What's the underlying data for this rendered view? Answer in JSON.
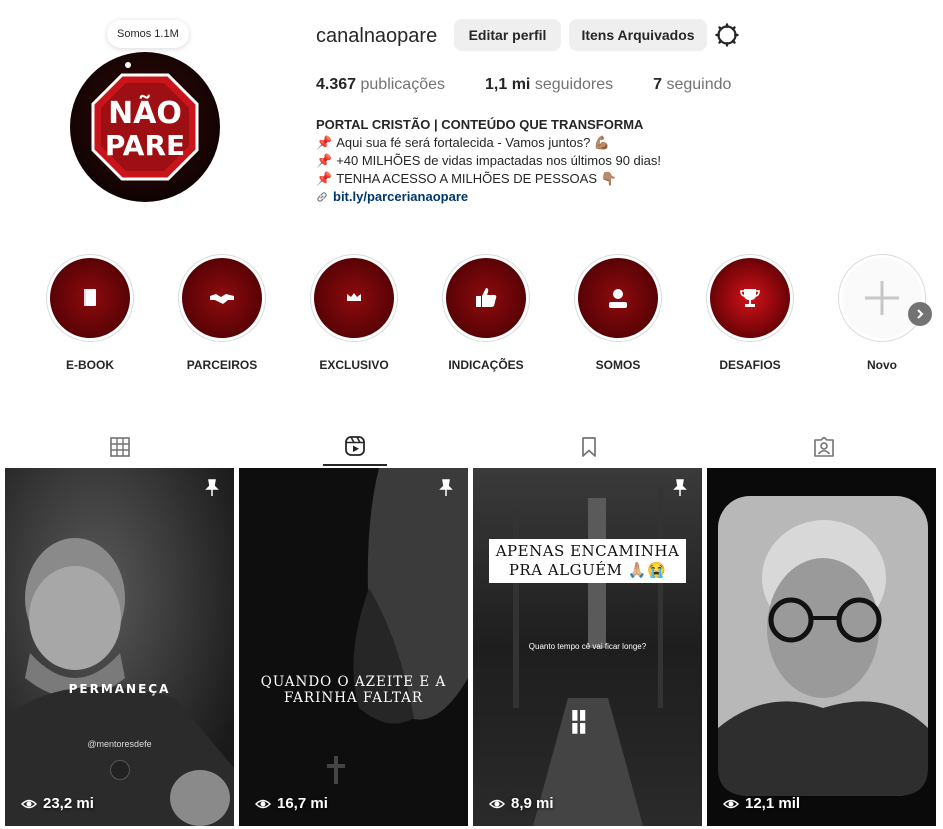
{
  "profile": {
    "username": "canalnaopare",
    "note": "Somos 1.1M",
    "avatar_text_top": "NÃO",
    "avatar_text_bottom": "PARE",
    "edit_label": "Editar perfil",
    "archive_label": "Itens Arquivados",
    "settings_icon": "gear-icon"
  },
  "stats": {
    "posts_value": "4.367",
    "posts_label": "publicações",
    "followers_value": "1,1 mi",
    "followers_label": "seguidores",
    "following_value": "7",
    "following_label": "seguindo"
  },
  "bio": {
    "name": "PORTAL CRISTÃO | CONTEÚDO QUE TRANSFORMA",
    "line1": "Aqui sua fé será fortalecida - Vamos juntos? 💪🏽",
    "line2": "+40 MILHÕES de vidas impactadas nos últimos 90 dias!",
    "line3": "TENHA ACESSO A MILHÕES DE PESSOAS 👇🏽",
    "link": "bit.ly/parcerianaopare"
  },
  "highlights": [
    {
      "label": "E-BOOK",
      "icon": "book-icon"
    },
    {
      "label": "PARCEIROS",
      "icon": "handshake-icon"
    },
    {
      "label": "EXCLUSIVO",
      "icon": "crown-icon"
    },
    {
      "label": "INDICAÇÕES",
      "icon": "thumbs-up-icon"
    },
    {
      "label": "SOMOS",
      "icon": "person-icon"
    },
    {
      "label": "DESAFIOS",
      "icon": "trophy-icon"
    },
    {
      "label": "Novo",
      "icon": "plus-icon"
    }
  ],
  "tabs": [
    {
      "name": "posts",
      "icon": "grid-icon",
      "active": false
    },
    {
      "name": "reels",
      "icon": "reels-icon",
      "active": true
    },
    {
      "name": "saved",
      "icon": "bookmark-icon",
      "active": false
    },
    {
      "name": "tagged",
      "icon": "tagged-icon",
      "active": false
    }
  ],
  "reels": [
    {
      "views": "23,2 mi",
      "pinned": true,
      "caption": "PERMANEÇA",
      "handle": "@mentoresdefe"
    },
    {
      "views": "16,7 mi",
      "pinned": true,
      "caption": "QUANDO O AZEITE E A FARINHA FALTAR"
    },
    {
      "views": "8,9 mi",
      "pinned": true,
      "caption": "APENAS ENCAMINHA PRA ALGUÉM 🙏🏼😭",
      "subcaption": "Quanto tempo cê vai ficar longe?"
    },
    {
      "views": "12,1 mil",
      "pinned": false
    }
  ],
  "colors": {
    "brand_red": "#c8141b",
    "link": "#00376b",
    "button_bg": "#efefef"
  }
}
